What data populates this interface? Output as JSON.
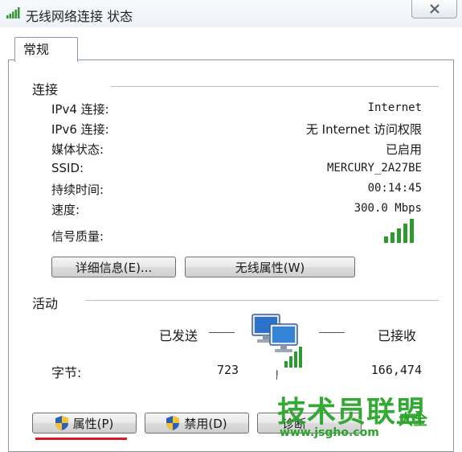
{
  "window": {
    "title": "无线网络连接 状态"
  },
  "tabs": [
    {
      "label": "常规"
    }
  ],
  "connection": {
    "heading": "连接",
    "rows": [
      {
        "label": "IPv4 连接:",
        "value": "Internet"
      },
      {
        "label": "IPv6 连接:",
        "value": "无 Internet 访问权限"
      },
      {
        "label": "媒体状态:",
        "value": "已启用"
      },
      {
        "label": "SSID:",
        "value": "MERCURY_2A27BE"
      },
      {
        "label": "持续时间:",
        "value": "00:14:45"
      },
      {
        "label": "速度:",
        "value": "300.0 Mbps"
      }
    ],
    "signal": {
      "label": "信号质量:",
      "bars": 5,
      "filled": 5
    },
    "buttons": {
      "details": "详细信息(E)...",
      "wireless_props": "无线属性(W)"
    }
  },
  "activity": {
    "heading": "活动",
    "sent_label": "已发送",
    "received_label": "已接收",
    "bytes_label": "字节:",
    "bytes_sent": "723",
    "bytes_received": "166,474"
  },
  "bottom_buttons": {
    "properties": "属性(P)",
    "disable": "禁用(D)",
    "diagnose": "诊断"
  },
  "watermark": {
    "main": "技术员联盟",
    "side": "大全",
    "url": "www.jsgho.com"
  },
  "colors": {
    "signal": "#2c9a2c",
    "accent_underline": "#d51b2b",
    "watermark": "#2aa52a"
  }
}
